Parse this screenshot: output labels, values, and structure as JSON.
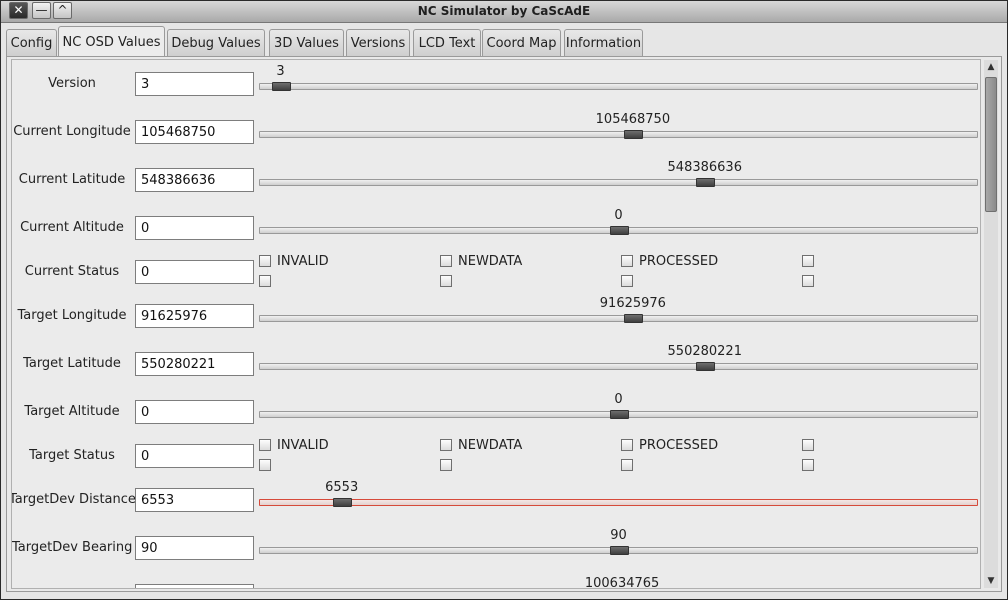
{
  "window": {
    "title": "NC Simulator by CaScAdE",
    "close_label": "✕",
    "minimize_label": "—",
    "maximize_label": "^"
  },
  "tabs": [
    {
      "label": "Config"
    },
    {
      "label": "NC OSD Values",
      "active": true
    },
    {
      "label": "Debug Values"
    },
    {
      "label": "3D Values"
    },
    {
      "label": "Versions"
    },
    {
      "label": "LCD Text"
    },
    {
      "label": "Coord Map"
    },
    {
      "label": "Information"
    }
  ],
  "rows": {
    "version": {
      "label": "Version",
      "value": "3",
      "slider_text": "3",
      "slider_position": 0.03
    },
    "current_longitude": {
      "label": "Current Longitude",
      "value": "105468750",
      "slider_text": "105468750",
      "slider_position": 0.52
    },
    "current_latitude": {
      "label": "Current Latitude",
      "value": "548386636",
      "slider_text": "548386636",
      "slider_position": 0.62
    },
    "current_altitude": {
      "label": "Current Altitude",
      "value": "0",
      "slider_text": "0",
      "slider_position": 0.5
    },
    "current_status": {
      "label": "Current Status",
      "value": "0"
    },
    "target_longitude": {
      "label": "Target Longitude",
      "value": "91625976",
      "slider_text": "91625976",
      "slider_position": 0.52
    },
    "target_latitude": {
      "label": "Target Latitude",
      "value": "550280221",
      "slider_text": "550280221",
      "slider_position": 0.62
    },
    "target_altitude": {
      "label": "Target Altitude",
      "value": "0",
      "slider_text": "0",
      "slider_position": 0.5
    },
    "target_status": {
      "label": "Target Status",
      "value": "0"
    },
    "targetdev_distance": {
      "label": "TargetDev Distance",
      "value": "6553",
      "slider_text": "6553",
      "slider_position": 0.115
    },
    "targetdev_bearing": {
      "label": "TargetDev Bearing",
      "value": "90",
      "slider_text": "90",
      "slider_position": 0.5
    },
    "partial_row": {
      "slider_text": "100634765"
    }
  },
  "status_flags": [
    "INVALID",
    "NEWDATA",
    "PROCESSED"
  ],
  "colors": {
    "alert_track": "#d64a3a",
    "thumb": "#4f4f4f"
  }
}
